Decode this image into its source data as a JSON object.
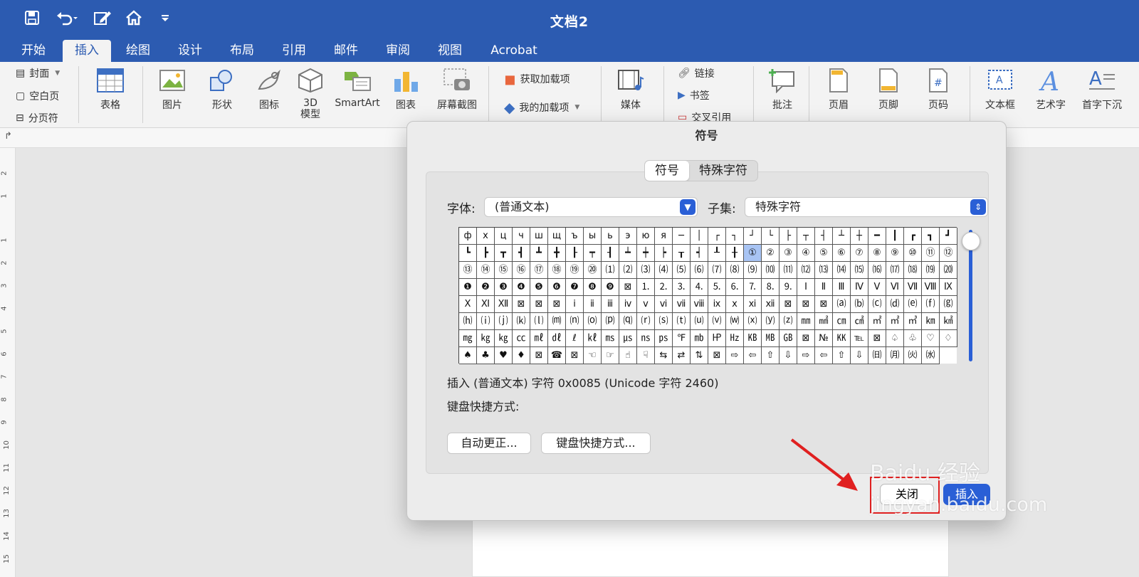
{
  "window": {
    "title": "文档2"
  },
  "quick_access": {
    "icons": [
      "save-icon",
      "undo-icon",
      "edit-icon",
      "home-icon",
      "customize-icon"
    ]
  },
  "tabs": [
    {
      "label": "开始"
    },
    {
      "label": "插入"
    },
    {
      "label": "绘图"
    },
    {
      "label": "设计"
    },
    {
      "label": "布局"
    },
    {
      "label": "引用"
    },
    {
      "label": "邮件"
    },
    {
      "label": "审阅"
    },
    {
      "label": "视图"
    },
    {
      "label": "Acrobat"
    }
  ],
  "active_tab": "插入",
  "ribbon": {
    "pages": [
      "封面",
      "空白页",
      "分页符"
    ],
    "table": "表格",
    "picture": "图片",
    "shapes": "形状",
    "icons": "图标",
    "model3d": "3D 模型",
    "smartart": "SmartArt",
    "chart": "图表",
    "screenshot": "屏幕截图",
    "get_addins": "获取加载项",
    "my_addins": "我的加载项",
    "media": "媒体",
    "link": "链接",
    "bookmark": "书签",
    "crossref": "交叉引用",
    "comment": "批注",
    "header": "页眉",
    "footer": "页脚",
    "page_number": "页码",
    "textbox": "文本框",
    "wordart": "艺术字",
    "dropcap": "首字下沉"
  },
  "ruler_numbers": [
    "2",
    "1",
    "1",
    "2",
    "3",
    "4",
    "5",
    "6",
    "7",
    "8",
    "9",
    "10",
    "11",
    "12",
    "13",
    "14",
    "15"
  ],
  "dialog": {
    "title": "符号",
    "tabs": [
      "符号",
      "特殊字符"
    ],
    "font_label": "字体:",
    "font_value": "(普通文本)",
    "subset_label": "子集:",
    "subset_value": "特殊字符",
    "selected_char": "①",
    "symbols": [
      [
        "ф",
        "х",
        "ц",
        "ч",
        "ш",
        "щ",
        "ъ",
        "ы",
        "ь",
        "э",
        "ю",
        "я",
        "─",
        "│",
        "┌",
        "┐",
        "┘",
        "└",
        "├",
        "┬",
        "┤",
        "┴",
        "┼",
        "━",
        "┃",
        "┏",
        "┓",
        "┛"
      ],
      [
        "┗",
        "┣",
        "┳",
        "┫",
        "┻",
        "╋",
        "┠",
        "┯",
        "┨",
        "┷",
        "┿",
        "┝",
        "┰",
        "┥",
        "┸",
        "╂",
        "①",
        "②",
        "③",
        "④",
        "⑤",
        "⑥",
        "⑦",
        "⑧",
        "⑨",
        "⑩",
        "⑪",
        "⑫"
      ],
      [
        "⑬",
        "⑭",
        "⑮",
        "⑯",
        "⑰",
        "⑱",
        "⑲",
        "⑳",
        "⑴",
        "⑵",
        "⑶",
        "⑷",
        "⑸",
        "⑹",
        "⑺",
        "⑻",
        "⑼",
        "⑽",
        "⑾",
        "⑿",
        "⒀",
        "⒁",
        "⒂",
        "⒃",
        "⒄",
        "⒅",
        "⒆",
        "⒇"
      ],
      [
        "❶",
        "❷",
        "❸",
        "❹",
        "❺",
        "❻",
        "❼",
        "❽",
        "❾",
        "⊠",
        "⒈",
        "⒉",
        "⒊",
        "⒋",
        "⒌",
        "⒍",
        "⒎",
        "⒏",
        "⒐",
        "Ⅰ",
        "Ⅱ",
        "Ⅲ",
        "Ⅳ",
        "Ⅴ",
        "Ⅵ",
        "Ⅶ",
        "Ⅷ",
        "Ⅸ"
      ],
      [
        "Ⅹ",
        "Ⅺ",
        "Ⅻ",
        "⊠",
        "⊠",
        "⊠",
        "ⅰ",
        "ⅱ",
        "ⅲ",
        "ⅳ",
        "ⅴ",
        "ⅵ",
        "ⅶ",
        "ⅷ",
        "ⅸ",
        "ⅹ",
        "ⅺ",
        "ⅻ",
        "⊠",
        "⊠",
        "⊠",
        "⒜",
        "⒝",
        "⒞",
        "⒟",
        "⒠",
        "⒡",
        "⒢"
      ],
      [
        "⒣",
        "⒤",
        "⒥",
        "⒦",
        "⒧",
        "⒨",
        "⒩",
        "⒪",
        "⒫",
        "⒬",
        "⒭",
        "⒮",
        "⒯",
        "⒰",
        "⒱",
        "⒲",
        "⒳",
        "⒴",
        "⒵",
        "㎜",
        "㎟",
        "㎝",
        "㎠",
        "㎡",
        "㎡",
        "㎥",
        "㎞"
      ],
      [
        "㎢",
        "㎎",
        "㎏",
        "㎏",
        "㏄",
        "㎖",
        "㎗",
        "ℓ",
        "㎘",
        "㎳",
        "㎲",
        "㎱",
        "㎰",
        "℉",
        "㏔",
        "㏋",
        "㎐",
        "㎅",
        "㎆",
        "㎇",
        "⊠",
        "№",
        "㏍",
        "℡",
        "⊠",
        "♤",
        "♧",
        "♡"
      ],
      [
        "♢",
        "♠",
        "♣",
        "♥",
        "♦",
        "⊠",
        "☎",
        "⊠",
        "☜",
        "☞",
        "☝",
        "☟",
        "⇆",
        "⇄",
        "⇅",
        "⊠",
        "⇨",
        "⇦",
        "⇧",
        "⇩",
        "⇨",
        "⇦",
        "⇧",
        "⇩",
        "㈰",
        "㈪",
        "㈫",
        "㈬"
      ]
    ],
    "info_text": "插入 (普通文本) 字符 0x0085 (Unicode 字符 2460)",
    "shortcut_label": "键盘快捷方式:",
    "autocorrect_button": "自动更正...",
    "shortcut_button": "键盘快捷方式...",
    "close_button": "关闭",
    "insert_button": "插入"
  },
  "watermark": {
    "brand": "Baidu 经验",
    "url": "jingyan.baidu.com"
  },
  "colors": {
    "accent": "#2c5bb1",
    "highlight": "#e02020",
    "primary_button": "#2a5fd6"
  }
}
